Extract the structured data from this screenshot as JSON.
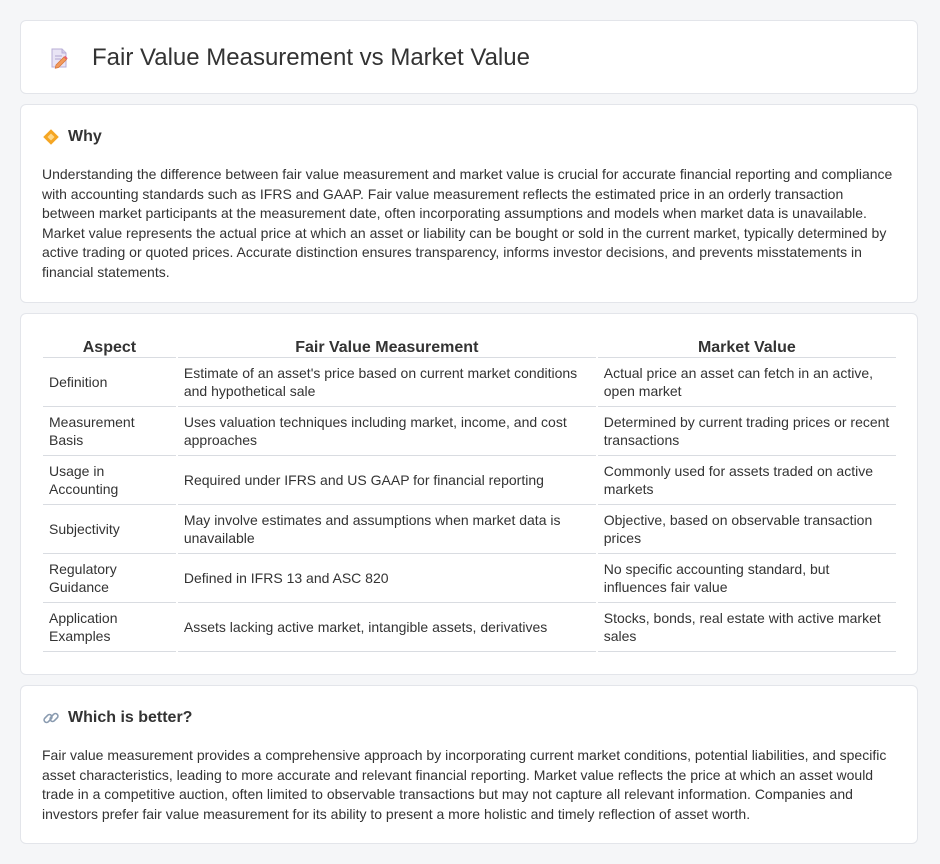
{
  "header": {
    "title": "Fair Value Measurement vs Market Value",
    "icon": "document-pencil-icon"
  },
  "why": {
    "heading": "Why",
    "icon": "diamond-icon",
    "text": "Understanding the difference between fair value measurement and market value is crucial for accurate financial reporting and compliance with accounting standards such as IFRS and GAAP. Fair value measurement reflects the estimated price in an orderly transaction between market participants at the measurement date, often incorporating assumptions and models when market data is unavailable. Market value represents the actual price at which an asset or liability can be bought or sold in the current market, typically determined by active trading or quoted prices. Accurate distinction ensures transparency, informs investor decisions, and prevents misstatements in financial statements."
  },
  "table": {
    "headers": [
      "Aspect",
      "Fair Value Measurement",
      "Market Value"
    ],
    "rows": [
      [
        "Definition",
        "Estimate of an asset's price based on current market conditions and hypothetical sale",
        "Actual price an asset can fetch in an active, open market"
      ],
      [
        "Measurement Basis",
        "Uses valuation techniques including market, income, and cost approaches",
        "Determined by current trading prices or recent transactions"
      ],
      [
        "Usage in Accounting",
        "Required under IFRS and US GAAP for financial reporting",
        "Commonly used for assets traded on active markets"
      ],
      [
        "Subjectivity",
        "May involve estimates and assumptions when market data is unavailable",
        "Objective, based on observable transaction prices"
      ],
      [
        "Regulatory Guidance",
        "Defined in IFRS 13 and ASC 820",
        "No specific accounting standard, but influences fair value"
      ],
      [
        "Application Examples",
        "Assets lacking active market, intangible assets, derivatives",
        "Stocks, bonds, real estate with active market sales"
      ]
    ]
  },
  "better": {
    "heading": "Which is better?",
    "icon": "link-icon",
    "text": "Fair value measurement provides a comprehensive approach by incorporating current market conditions, potential liabilities, and specific asset characteristics, leading to more accurate and relevant financial reporting. Market value reflects the price at which an asset would trade in a competitive auction, often limited to observable transactions but may not capture all relevant information. Companies and investors prefer fair value measurement for its ability to present a more holistic and timely reflection of asset worth."
  }
}
